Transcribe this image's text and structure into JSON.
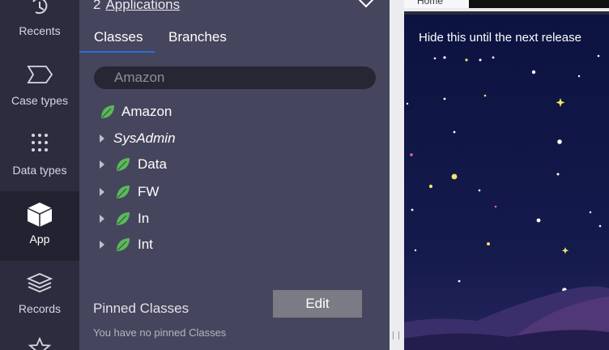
{
  "nav": {
    "items": [
      {
        "label": "Recents",
        "icon": "history-icon"
      },
      {
        "label": "Case types",
        "icon": "case-type-icon"
      },
      {
        "label": "Data types",
        "icon": "data-grid-icon"
      },
      {
        "label": "App",
        "icon": "cube-icon",
        "active": true
      },
      {
        "label": "Records",
        "icon": "layers-icon"
      },
      {
        "label": "",
        "icon": "star-icon"
      }
    ]
  },
  "explorer": {
    "apps_count": "2",
    "apps_link": "Applications",
    "tabs": [
      "Classes",
      "Branches"
    ],
    "search_value": "Amazon",
    "tree": [
      {
        "label": "Amazon",
        "expandable": false,
        "leaf": true,
        "italic": false
      },
      {
        "label": "SysAdmin",
        "expandable": true,
        "leaf": false,
        "italic": true
      },
      {
        "label": "Data",
        "expandable": true,
        "leaf": true,
        "italic": false
      },
      {
        "label": "FW",
        "expandable": true,
        "leaf": true,
        "italic": false
      },
      {
        "label": "In",
        "expandable": true,
        "leaf": true,
        "italic": false
      },
      {
        "label": "Int",
        "expandable": true,
        "leaf": true,
        "italic": false
      }
    ],
    "pinned_title": "Pinned Classes",
    "pinned_empty": "You have no pinned Classes",
    "edit_label": "Edit"
  },
  "preview": {
    "home_tab": "Home",
    "banner": "Hide this until the next release"
  },
  "colors": {
    "leaf_green": "#5cb85c",
    "accent_blue": "#2f6ed8",
    "sky_top": "#0c1340",
    "sky_bottom": "#25245a"
  }
}
